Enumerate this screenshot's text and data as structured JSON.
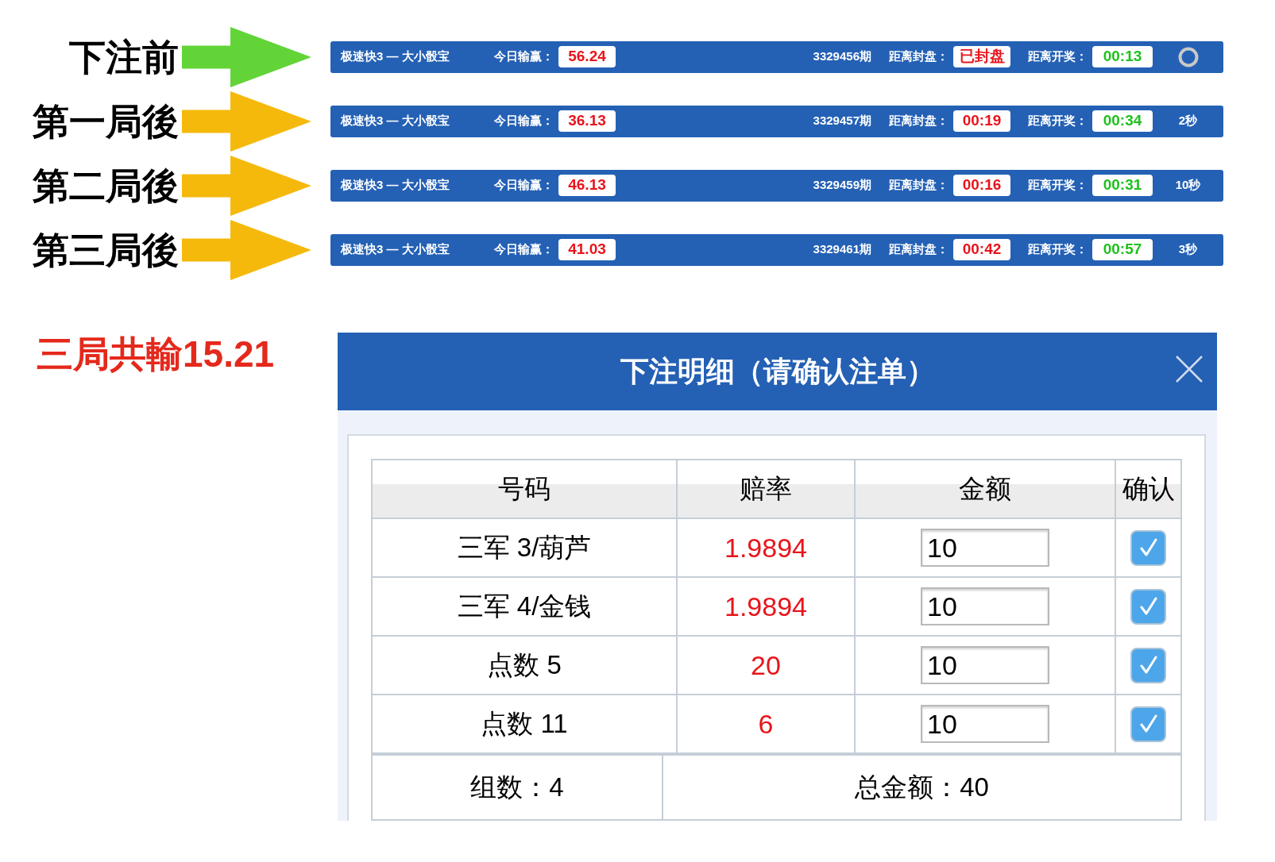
{
  "stages": [
    {
      "label": "下注前",
      "color": "#62d438",
      "bar": {
        "game": "极速快3 — 大小骰宝",
        "profit_label": "今日输赢：",
        "profit": "56.24",
        "period": "3329456期",
        "close_label": "距离封盘：",
        "close_countdown": "已封盘",
        "draw_label": "距离开奖：",
        "draw_countdown": "00:13",
        "trailing": {
          "kind": "spinner"
        }
      }
    },
    {
      "label": "第一局後",
      "color": "#f5b90c",
      "bar": {
        "game": "极速快3 — 大小骰宝",
        "profit_label": "今日输赢：",
        "profit": "36.13",
        "period": "3329457期",
        "close_label": "距离封盘：",
        "close_countdown": "00:19",
        "draw_label": "距离开奖：",
        "draw_countdown": "00:34",
        "trailing": {
          "kind": "text",
          "text": "2秒"
        }
      }
    },
    {
      "label": "第二局後",
      "color": "#f5b90c",
      "bar": {
        "game": "极速快3 — 大小骰宝",
        "profit_label": "今日输赢：",
        "profit": "46.13",
        "period": "3329459期",
        "close_label": "距离封盘：",
        "close_countdown": "00:16",
        "draw_label": "距离开奖：",
        "draw_countdown": "00:31",
        "trailing": {
          "kind": "text",
          "text": "10秒"
        }
      }
    },
    {
      "label": "第三局後",
      "color": "#f5b90c",
      "bar": {
        "game": "极速快3 — 大小骰宝",
        "profit_label": "今日输赢：",
        "profit": "41.03",
        "period": "3329461期",
        "close_label": "距离封盘：",
        "close_countdown": "00:42",
        "draw_label": "距离开奖：",
        "draw_countdown": "00:57",
        "trailing": {
          "kind": "text",
          "text": "3秒"
        }
      }
    }
  ],
  "summary": "三局共輸15.21",
  "dialog": {
    "title": "下注明细（请确认注单）",
    "columns": [
      "号码",
      "赔率",
      "金额",
      "确认"
    ],
    "rows": [
      {
        "number": "三军 3/葫芦",
        "odds": "1.9894",
        "amount": "10",
        "confirmed": true
      },
      {
        "number": "三军 4/金钱",
        "odds": "1.9894",
        "amount": "10",
        "confirmed": true
      },
      {
        "number": "点数 5",
        "odds": "20",
        "amount": "10",
        "confirmed": true
      },
      {
        "number": "点数 11",
        "odds": "6",
        "amount": "10",
        "confirmed": true
      }
    ],
    "footer": {
      "group_count": "组数：4",
      "total_amount": "总金额：40"
    }
  }
}
